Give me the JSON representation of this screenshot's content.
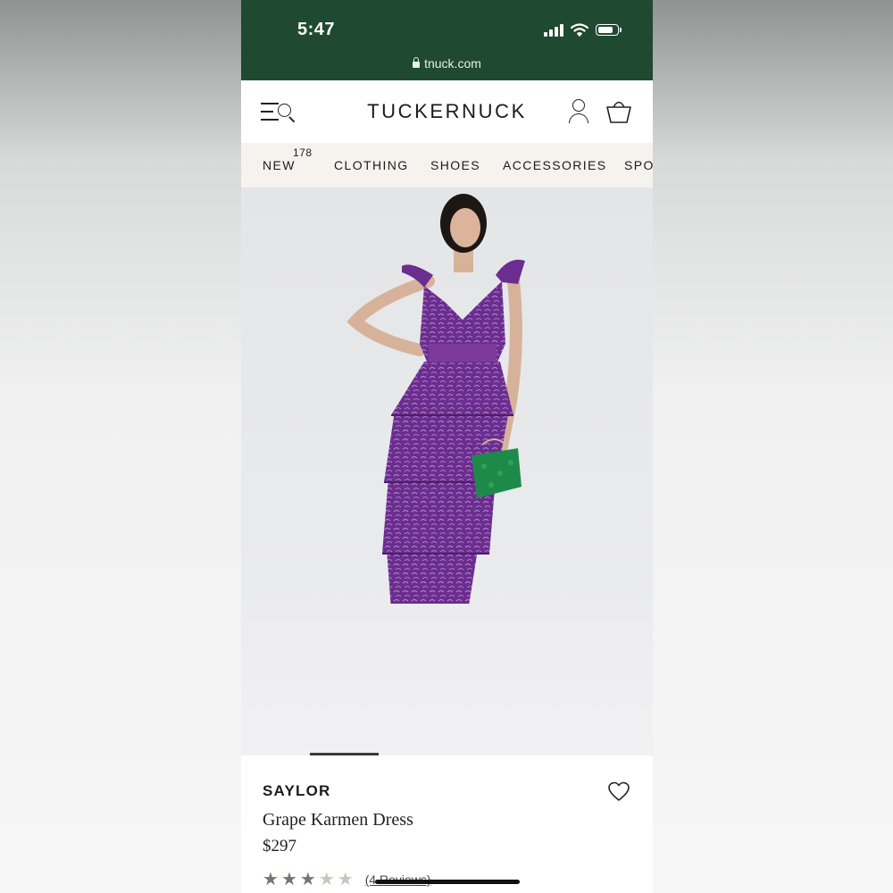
{
  "status_bar": {
    "time": "5:47",
    "url": "tnuck.com",
    "battery_level": 0.85
  },
  "header": {
    "logo": "TUCKERNUCK"
  },
  "categories": [
    {
      "label": "NEW",
      "badge": "178"
    },
    {
      "label": "CLOTHING"
    },
    {
      "label": "SHOES"
    },
    {
      "label": "ACCESSORIES"
    },
    {
      "label": "SPO"
    }
  ],
  "carousel": {
    "current_slide": 1
  },
  "product": {
    "brand": "SAYLOR",
    "name": "Grape Karmen Dress",
    "price": "$297",
    "rating": 3,
    "rating_max": 5,
    "reviews_text": "(4 Reviews)"
  },
  "icons": {
    "menu": "menu-search-icon",
    "account": "account-icon",
    "bag": "bag-icon",
    "wishlist": "heart-icon"
  },
  "colors": {
    "status_bar": "#1f4a31",
    "nav_background": "#f6f3ee",
    "dress": "#6b2d8f",
    "handbag": "#1e8a4a",
    "star_filled": "#7d7469",
    "star_empty": "#c9c4bd"
  }
}
